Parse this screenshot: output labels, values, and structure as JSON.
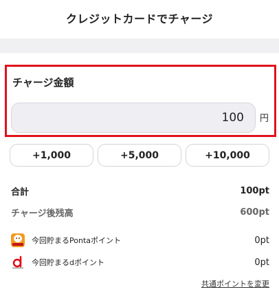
{
  "header": {
    "title": "クレジットカードでチャージ"
  },
  "charge": {
    "label": "チャージ金額",
    "amount": "100",
    "unit": "円",
    "highlight_color": "#e0121c"
  },
  "presets": [
    "+1,000",
    "+5,000",
    "+10,000"
  ],
  "summary": {
    "total_label": "合計",
    "total_value": "100pt",
    "balance_label": "チャージ後残高",
    "balance_value": "600pt"
  },
  "points": [
    {
      "label": "今回貯まるPontaポイント",
      "value": "0pt",
      "icon": "ponta-icon",
      "icon_color": "#f39a1d"
    },
    {
      "label": "今回貯まるdポイント",
      "value": "0pt",
      "icon": "d-point-icon",
      "icon_color": "#e60012"
    }
  ],
  "change_link": "共通ポイントを変更"
}
